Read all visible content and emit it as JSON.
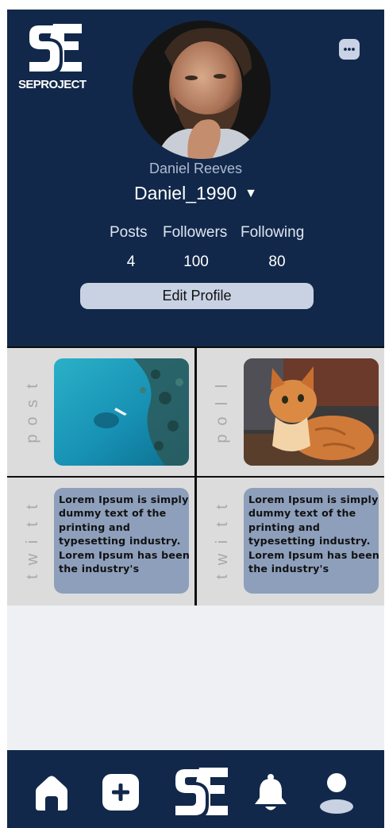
{
  "header": {
    "brand_text": "SEPROJECT",
    "more_icon": "more-dots-icon",
    "full_name": "Daniel Reeves",
    "username": "Daniel_1990",
    "username_caret": "▼",
    "stats": [
      {
        "label": "Posts",
        "value": "4"
      },
      {
        "label": "Followers",
        "value": "100"
      },
      {
        "label": "Following",
        "value": "80"
      }
    ],
    "edit_profile_label": "Edit Profile"
  },
  "grid": {
    "cells": [
      {
        "type": "post",
        "side_label": "post",
        "content": "image",
        "image": "aerial-sea-boat"
      },
      {
        "type": "poll",
        "side_label": "poll",
        "content": "image",
        "image": "orange-cat"
      },
      {
        "type": "twitt",
        "side_label": "twitt",
        "content": "text",
        "text": "Lorem Ipsum is simply dummy text of the printing and typesetting industry. Lorem Ipsum has been the industry's"
      },
      {
        "type": "twitt",
        "side_label": "twitt",
        "content": "text",
        "text": "Lorem Ipsum is simply dummy text of the printing and typesetting industry. Lorem Ipsum has been the industry's"
      }
    ]
  },
  "bottom_nav": {
    "items": [
      "home-icon",
      "add-icon",
      "se-logo",
      "bell-icon",
      "profile-icon"
    ]
  },
  "colors": {
    "navy": "#11284a",
    "button": "#c8d2e3",
    "tweet_card": "#8d9fbb",
    "cell_bg": "#dcdcdc",
    "page_bg": "#eef0f4"
  }
}
